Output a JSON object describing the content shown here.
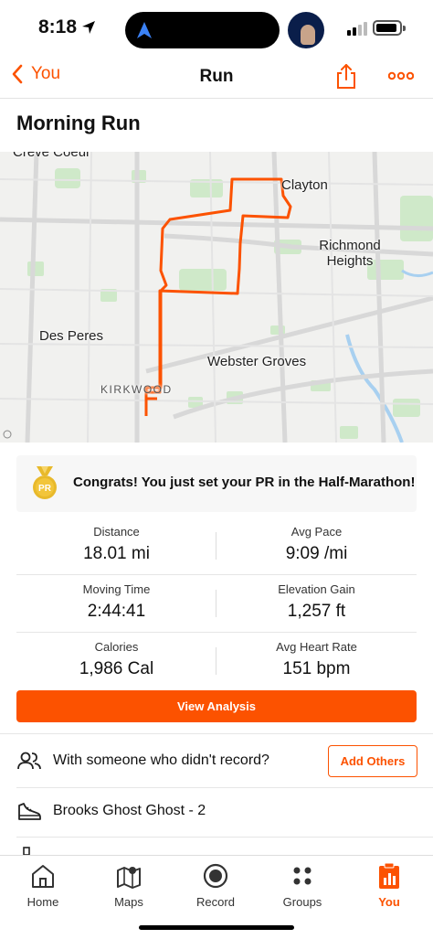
{
  "status_bar": {
    "time": "8:18"
  },
  "header": {
    "back_label": "You",
    "title": "Run"
  },
  "activity": {
    "title": "Morning Run"
  },
  "map": {
    "labels": {
      "creve_coeur": "Creve Coeur",
      "clayton": "Clayton",
      "richmond_heights": "Richmond Heights",
      "des_peres": "Des Peres",
      "webster_groves": "Webster Groves",
      "kirkwood": "KIRKWOOD"
    },
    "route_color": "#fc5200"
  },
  "pr_banner": {
    "medal_text": "PR",
    "message": "Congrats! You just set your PR in the Half-Marathon!"
  },
  "stats": {
    "distance": {
      "label": "Distance",
      "value": "18.01 mi"
    },
    "avg_pace": {
      "label": "Avg Pace",
      "value": "9:09 /mi"
    },
    "moving_time": {
      "label": "Moving Time",
      "value": "2:44:41"
    },
    "elevation_gain": {
      "label": "Elevation Gain",
      "value": "1,257 ft"
    },
    "calories": {
      "label": "Calories",
      "value": "1,986 Cal"
    },
    "avg_heart_rate": {
      "label": "Avg Heart Rate",
      "value": "151 bpm"
    }
  },
  "actions": {
    "view_analysis": "View Analysis"
  },
  "group_row": {
    "text": "With someone who didn't record?",
    "button": "Add Others"
  },
  "gear_row": {
    "text": "Brooks Ghost Ghost - 2"
  },
  "tabs": [
    {
      "label": "Home",
      "icon": "home-icon"
    },
    {
      "label": "Maps",
      "icon": "maps-icon"
    },
    {
      "label": "Record",
      "icon": "record-icon"
    },
    {
      "label": "Groups",
      "icon": "groups-icon"
    },
    {
      "label": "You",
      "icon": "you-icon",
      "active": true
    }
  ],
  "colors": {
    "accent": "#fc5200",
    "text": "#111111",
    "muted": "#333333"
  }
}
